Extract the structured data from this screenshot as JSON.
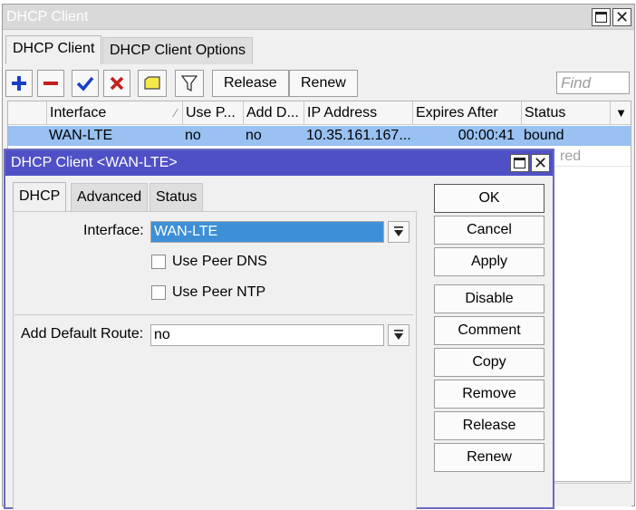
{
  "window": {
    "title": "DHCP Client"
  },
  "tabs": [
    "DHCP Client",
    "DHCP Client Options"
  ],
  "toolbar": {
    "release": "Release",
    "renew": "Renew",
    "find_placeholder": "Find"
  },
  "table": {
    "columns": [
      "Interface",
      "Use P...",
      "Add D...",
      "IP Address",
      "Expires After",
      "Status"
    ],
    "rows": [
      {
        "interface": "WAN-LTE",
        "use_peer": "no",
        "add_default": "no",
        "ip": "10.35.161.167...",
        "expires": "00:00:41",
        "status": "bound"
      },
      {
        "status_partial": "red"
      }
    ]
  },
  "dialog": {
    "title": "DHCP Client <WAN-LTE>",
    "tabs": [
      "DHCP",
      "Advanced",
      "Status"
    ],
    "interface_label": "Interface:",
    "interface_value": "WAN-LTE",
    "use_peer_dns": "Use Peer DNS",
    "use_peer_ntp": "Use Peer NTP",
    "default_route_label": "Add Default Route:",
    "default_route_value": "no",
    "buttons": [
      "OK",
      "Cancel",
      "Apply",
      "Disable",
      "Comment",
      "Copy",
      "Remove",
      "Release",
      "Renew"
    ]
  },
  "colors": {
    "selection": "#99c1f1",
    "dialog_title": "#5050c6",
    "add_icon": "#1a3fc7",
    "remove_icon": "#c42020",
    "check_icon": "#1a3fc7"
  }
}
